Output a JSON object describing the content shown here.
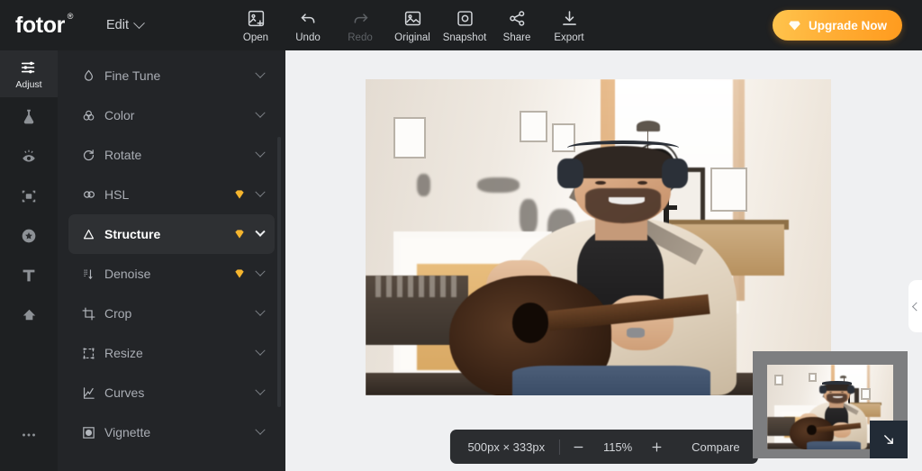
{
  "header": {
    "logo": "fotor",
    "logo_mark": "®",
    "edit_menu": "Edit",
    "tools": [
      {
        "label": "Open",
        "icon": "image-add-icon",
        "disabled": false
      },
      {
        "label": "Undo",
        "icon": "undo-arrow-icon",
        "disabled": false
      },
      {
        "label": "Redo",
        "icon": "redo-arrow-icon",
        "disabled": true
      },
      {
        "label": "Original",
        "icon": "image-icon",
        "disabled": false
      },
      {
        "label": "Snapshot",
        "icon": "camera-icon",
        "disabled": false
      },
      {
        "label": "Share",
        "icon": "share-nodes-icon",
        "disabled": false
      },
      {
        "label": "Export",
        "icon": "download-icon",
        "disabled": false
      }
    ],
    "upgrade_label": "Upgrade Now",
    "upgrade_icon": "gem-icon",
    "upgrade_color": "#ffa72b"
  },
  "rail": {
    "items": [
      {
        "label": "Adjust",
        "icon": "sliders-icon",
        "active": true
      },
      {
        "label": "",
        "icon": "flask-icon",
        "active": false
      },
      {
        "label": "",
        "icon": "eye-retouch-icon",
        "active": false
      },
      {
        "label": "",
        "icon": "frame-object-icon",
        "active": false
      },
      {
        "label": "",
        "icon": "star-badge-icon",
        "active": false
      },
      {
        "label": "",
        "icon": "text-t-icon",
        "active": false
      },
      {
        "label": "",
        "icon": "cloud-upload-icon",
        "active": false
      }
    ],
    "more_label": "more-options-icon"
  },
  "panel": {
    "items": [
      {
        "label": "Fine Tune",
        "icon": "droplet-icon",
        "pro": false,
        "active": false
      },
      {
        "label": "Color",
        "icon": "color-circles-icon",
        "pro": false,
        "active": false
      },
      {
        "label": "Rotate",
        "icon": "rotate-icon",
        "pro": false,
        "active": false
      },
      {
        "label": "HSL",
        "icon": "hsl-circles-icon",
        "pro": true,
        "active": false
      },
      {
        "label": "Structure",
        "icon": "triangle-icon",
        "pro": true,
        "active": true
      },
      {
        "label": "Denoise",
        "icon": "denoise-icon",
        "pro": true,
        "active": false
      },
      {
        "label": "Crop",
        "icon": "crop-icon",
        "pro": false,
        "active": false
      },
      {
        "label": "Resize",
        "icon": "resize-icon",
        "pro": false,
        "active": false
      },
      {
        "label": "Curves",
        "icon": "curves-icon",
        "pro": false,
        "active": false
      },
      {
        "label": "Vignette",
        "icon": "vignette-icon",
        "pro": false,
        "active": false
      }
    ],
    "pro_badge_color": "#f5b52e"
  },
  "canvas": {
    "image_alt": "man-with-headphones-playing-acoustic-guitar-in-home-studio",
    "background_color": "#eff0f2"
  },
  "controls": {
    "dimensions": "500px × 333px",
    "zoom_out_icon": "minus-icon",
    "zoom_level": "115%",
    "zoom_in_icon": "plus-icon",
    "compare_label": "Compare"
  },
  "minimap": {
    "collapse_icon": "arrow-down-right-icon"
  },
  "edge_panel": {
    "expand_icon": "chevron-left-icon"
  }
}
